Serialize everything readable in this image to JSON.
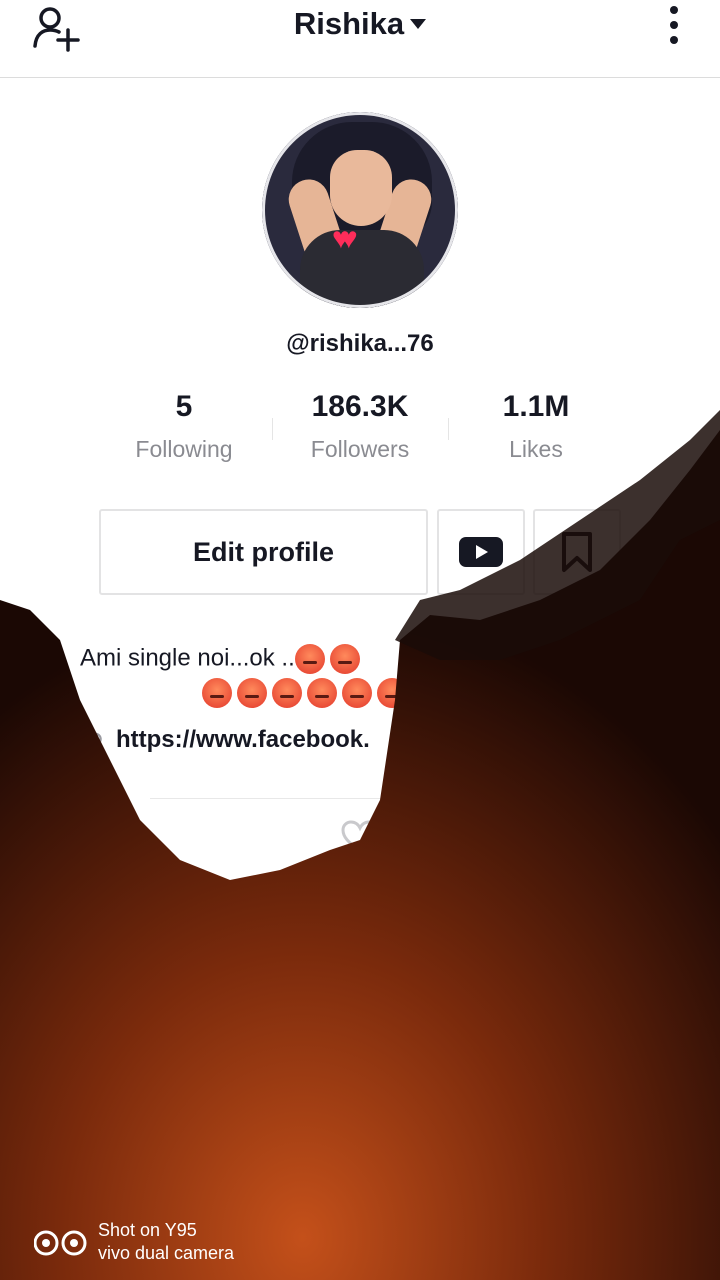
{
  "header": {
    "title": "Rishika"
  },
  "profile": {
    "username": "@rishika...76",
    "stats": [
      {
        "value": "5",
        "label": "Following"
      },
      {
        "value": "186.3K",
        "label": "Followers"
      },
      {
        "value": "1.1M",
        "label": "Likes"
      }
    ],
    "edit_label": "Edit profile",
    "bio_line1": "Ami  single noi...ok ..",
    "link": "https://www.facebook."
  },
  "watermark": {
    "line1": "Shot on Y95",
    "line2": "vivo dual camera"
  },
  "icons": {
    "add_user": "add-user-icon",
    "more": "more-vertical-icon",
    "youtube": "youtube-icon",
    "bookmark": "bookmark-icon",
    "link": "link-icon",
    "heart": "heart-icon"
  }
}
